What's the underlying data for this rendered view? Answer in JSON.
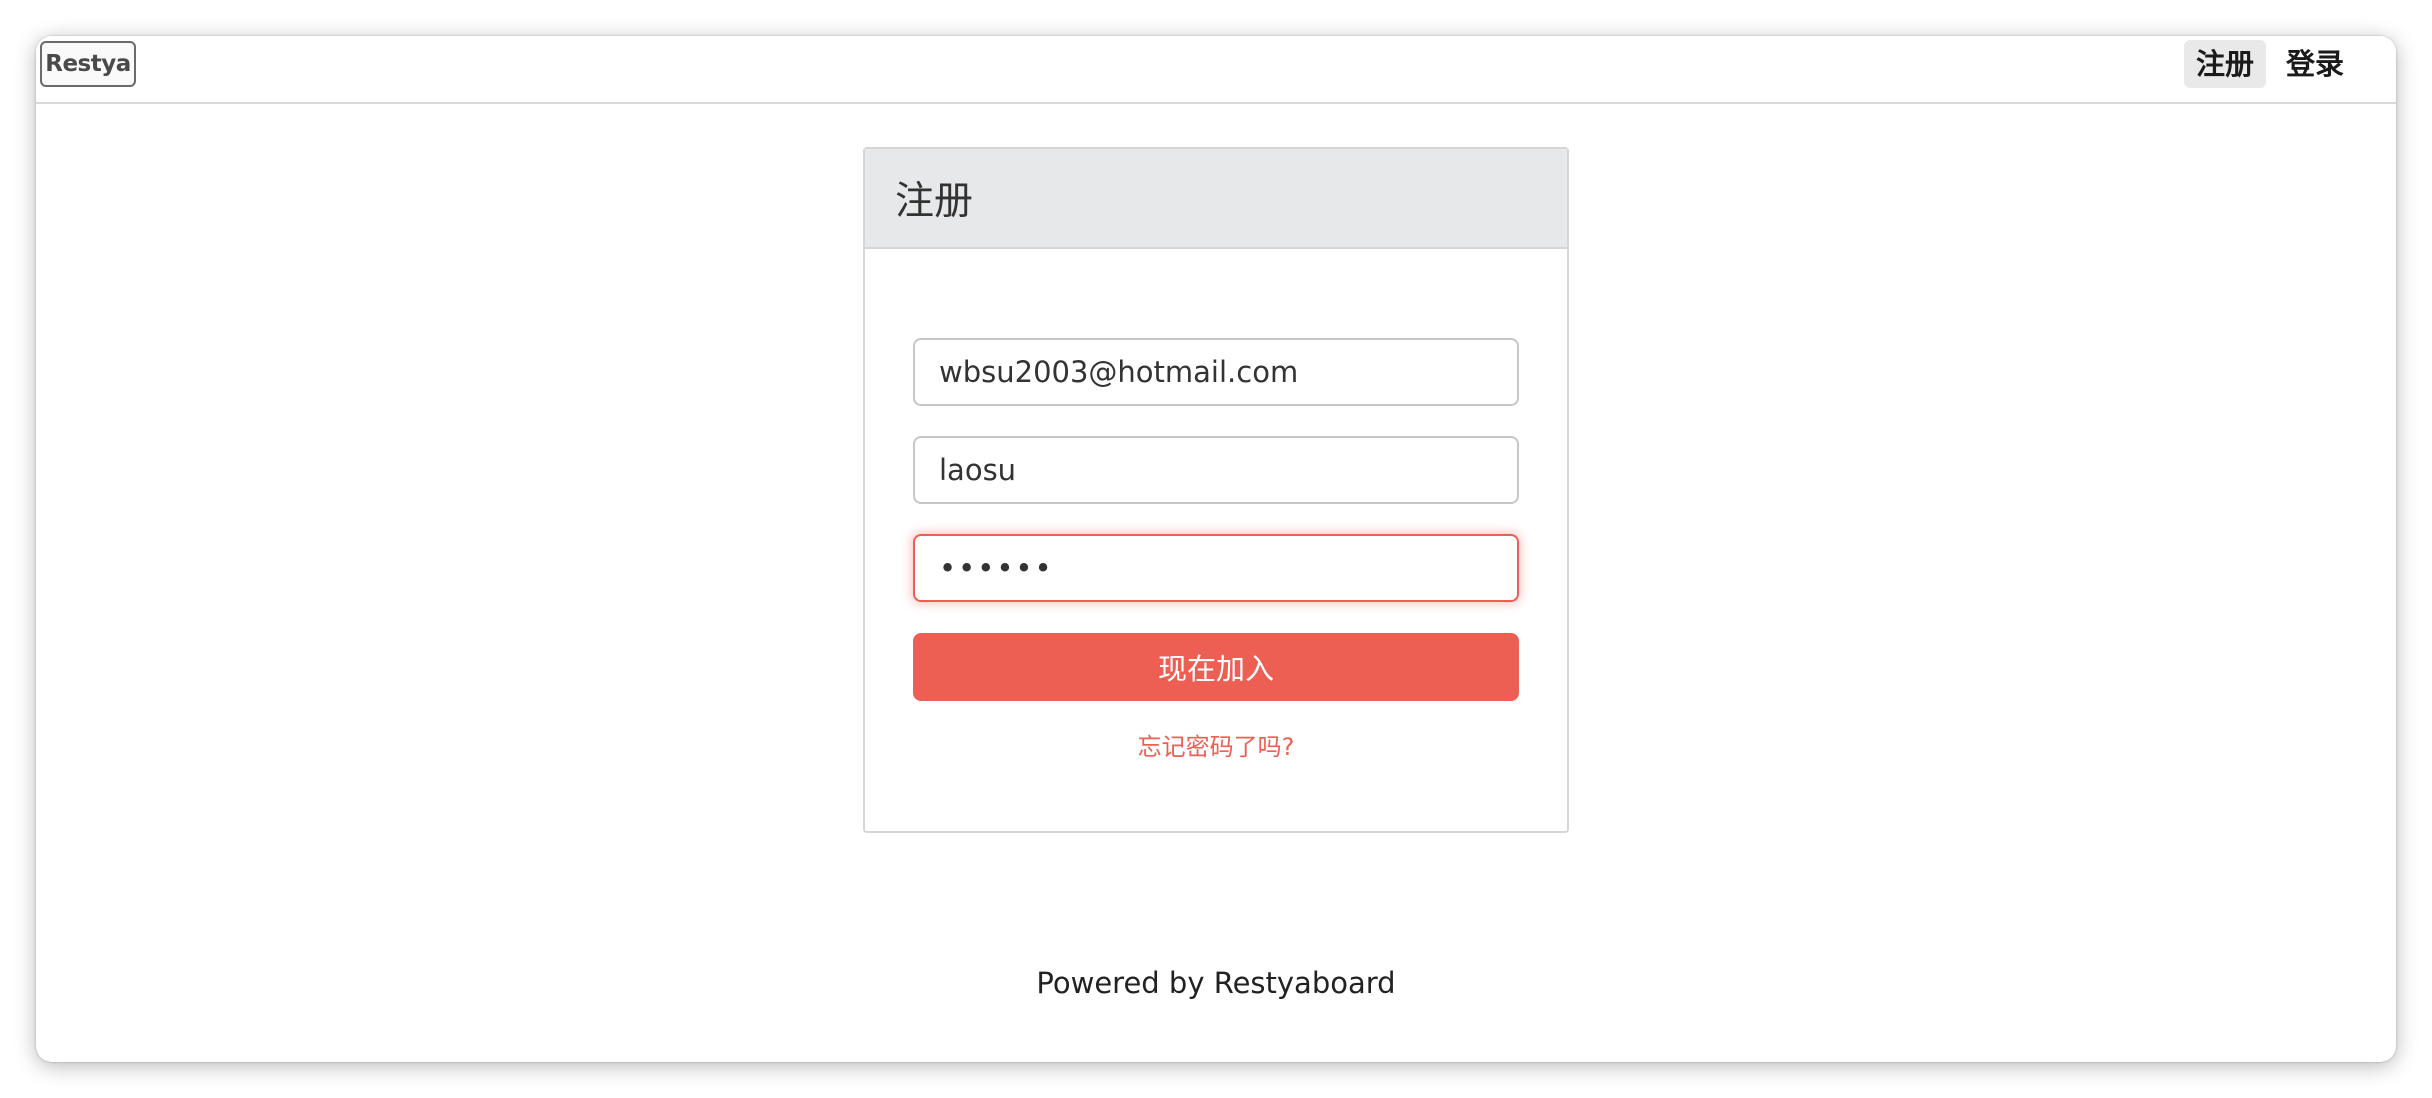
{
  "app": {
    "logo_text": "Restya"
  },
  "nav": {
    "register_label": "注册",
    "login_label": "登录"
  },
  "form": {
    "title": "注册",
    "email_value": "wbsu2003@hotmail.com",
    "username_value": "laosu",
    "password_value": "••••••",
    "submit_label": "现在加入",
    "forgot_label": "忘记密码了吗?"
  },
  "footer": {
    "text": "Powered by Restyaboard"
  },
  "colors": {
    "accent": "#ee5f53",
    "header_bg": "#e6e8ea"
  }
}
